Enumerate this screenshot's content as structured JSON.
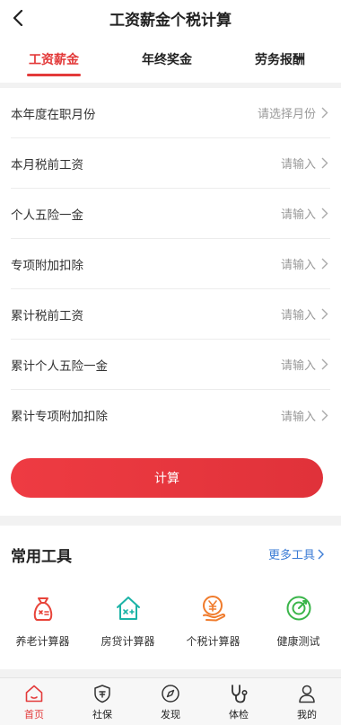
{
  "header": {
    "title": "工资薪金个税计算"
  },
  "tabs": [
    {
      "label": "工资薪金",
      "active": true
    },
    {
      "label": "年终奖金",
      "active": false
    },
    {
      "label": "劳务报酬",
      "active": false
    }
  ],
  "form": {
    "rows": [
      {
        "label": "本年度在职月份",
        "placeholder": "请选择月份"
      },
      {
        "label": "本月税前工资",
        "placeholder": "请输入"
      },
      {
        "label": "个人五险一金",
        "placeholder": "请输入"
      },
      {
        "label": "专项附加扣除",
        "placeholder": "请输入"
      },
      {
        "label": "累计税前工资",
        "placeholder": "请输入"
      },
      {
        "label": "累计个人五险一金",
        "placeholder": "请输入"
      },
      {
        "label": "累计专项附加扣除",
        "placeholder": "请输入"
      }
    ],
    "calculate_label": "计算"
  },
  "tools": {
    "title": "常用工具",
    "more_label": "更多工具",
    "items": [
      {
        "label": "养老计算器",
        "icon": "pension-bag-icon",
        "color": "#e8443a"
      },
      {
        "label": "房贷计算器",
        "icon": "house-loan-icon",
        "color": "#1bb3a6"
      },
      {
        "label": "个税计算器",
        "icon": "tax-yen-icon",
        "color": "#f07b2c"
      },
      {
        "label": "健康测试",
        "icon": "health-target-icon",
        "color": "#3ab54a"
      }
    ]
  },
  "nav": {
    "items": [
      {
        "label": "首页",
        "icon": "home-icon",
        "active": true
      },
      {
        "label": "社保",
        "icon": "shield-icon",
        "active": false
      },
      {
        "label": "发现",
        "icon": "compass-icon",
        "active": false
      },
      {
        "label": "体检",
        "icon": "stethoscope-icon",
        "active": false
      },
      {
        "label": "我的",
        "icon": "user-icon",
        "active": false
      }
    ]
  },
  "colors": {
    "accent": "#e33a3a",
    "link": "#3a7bd5"
  }
}
